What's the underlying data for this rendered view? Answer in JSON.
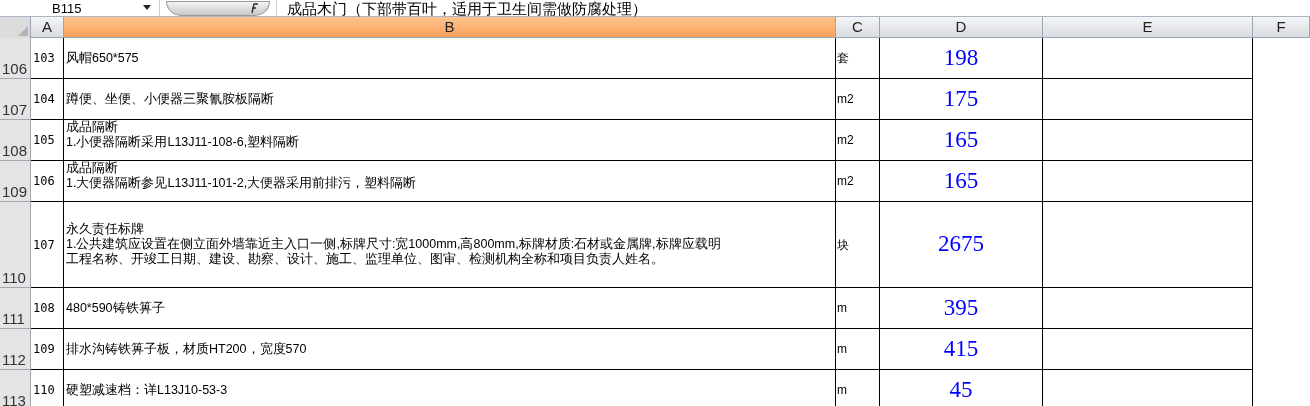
{
  "formula_bar": {
    "name_box": "B115",
    "formula": "成品木门（下部带百叶，适用于卫生间需做防腐处理）"
  },
  "columns": [
    {
      "label": "A",
      "selected": false
    },
    {
      "label": "B",
      "selected": true
    },
    {
      "label": "C",
      "selected": false
    },
    {
      "label": "D",
      "selected": false
    },
    {
      "label": "E",
      "selected": false
    },
    {
      "label": "F",
      "selected": false
    }
  ],
  "rows": [
    {
      "header": "106",
      "a": "103",
      "b": [
        "风帽650*575"
      ],
      "c": "套",
      "d": "198"
    },
    {
      "header": "107",
      "a": "104",
      "b": [
        "蹲便、坐便、小便器三聚氰胺板隔断"
      ],
      "c": "m2",
      "d": "175"
    },
    {
      "header": "108",
      "a": "105",
      "b": [
        "成品隔断",
        "1.小便器隔断采用L13J11-108-6,塑料隔断"
      ],
      "c": "m2",
      "d": "165"
    },
    {
      "header": "109",
      "a": "106",
      "b": [
        "成品隔断",
        "1.大便器隔断参见L13J11-101-2,大便器采用前排污，塑料隔断"
      ],
      "c": "m2",
      "d": "165"
    },
    {
      "header": "110",
      "a": "107",
      "b": [
        "永久责任标牌",
        "1.公共建筑应设置在侧立面外墙靠近主入口一侧,标牌尺寸:宽1000mm,高800mm,标牌材质:石材或金属牌,标牌应载明",
        "工程名称、开竣工日期、建设、勘察、设计、施工、监理单位、图审、检测机构全称和项目负责人姓名。"
      ],
      "c": "块",
      "d": "2675"
    },
    {
      "header": "111",
      "a": "108",
      "b": [
        "480*590铸铁箅子"
      ],
      "c": "m",
      "d": "395"
    },
    {
      "header": "112",
      "a": "109",
      "b": [
        "排水沟铸铁箅子板，材质HT200，宽度570"
      ],
      "c": "m",
      "d": "415"
    },
    {
      "header": "113",
      "a": "110",
      "b": [
        "硬塑减速档：详L13J10-53-3"
      ],
      "c": "m",
      "d": "45"
    }
  ]
}
